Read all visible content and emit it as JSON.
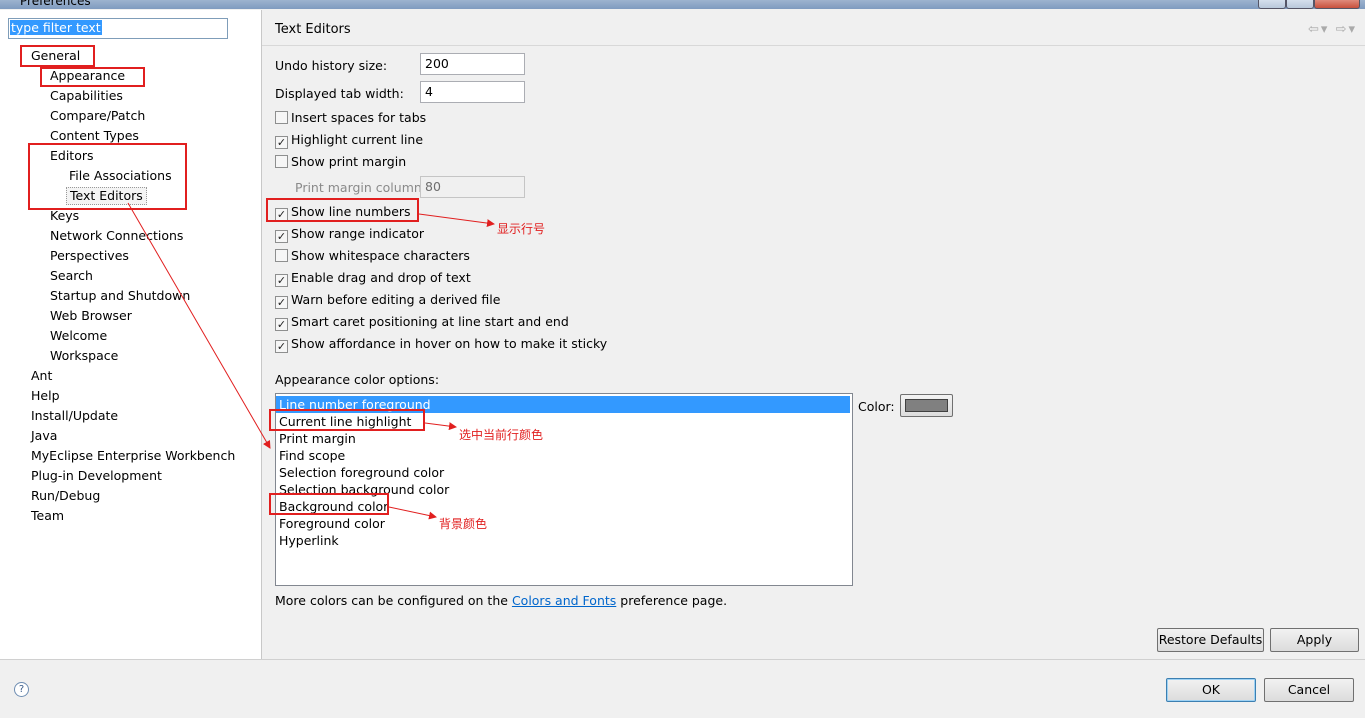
{
  "window": {
    "title": "Preferences"
  },
  "filter": {
    "text": "type filter text"
  },
  "tree": {
    "general": "General",
    "appearance": "Appearance",
    "capabilities": "Capabilities",
    "compare_patch": "Compare/Patch",
    "content_types": "Content Types",
    "editors": "Editors",
    "file_associations": "File Associations",
    "text_editors": "Text Editors",
    "keys": "Keys",
    "network_connections": "Network Connections",
    "perspectives": "Perspectives",
    "search": "Search",
    "startup_shutdown": "Startup and Shutdown",
    "web_browser": "Web Browser",
    "welcome": "Welcome",
    "workspace": "Workspace",
    "ant": "Ant",
    "help": "Help",
    "install_update": "Install/Update",
    "java": "Java",
    "myeclipse": "MyEclipse Enterprise Workbench",
    "plugin_dev": "Plug-in Development",
    "run_debug": "Run/Debug",
    "team": "Team"
  },
  "page": {
    "title": "Text Editors",
    "nav_icons": [
      "back-arrow-icon",
      "dropdown-icon",
      "forward-arrow-icon",
      "dropdown-icon"
    ],
    "undo_label": "Undo history size:",
    "undo_value": "200",
    "tab_label": "Displayed tab width:",
    "tab_value": "4",
    "print_margin_col_label": "Print margin column:",
    "print_margin_col_value": "80",
    "checkboxes": {
      "insert_spaces": {
        "label": "Insert spaces for tabs",
        "checked": false
      },
      "highlight_line": {
        "label": "Highlight current line",
        "checked": true
      },
      "print_margin": {
        "label": "Show print margin",
        "checked": false
      },
      "line_numbers": {
        "label": "Show line numbers",
        "checked": true
      },
      "range_indicator": {
        "label": "Show range indicator",
        "checked": true
      },
      "whitespace": {
        "label": "Show whitespace characters",
        "checked": false
      },
      "drag_drop": {
        "label": "Enable drag and drop of text",
        "checked": true
      },
      "warn_derived": {
        "label": "Warn before editing a derived file",
        "checked": true
      },
      "smart_caret": {
        "label": "Smart caret positioning at line start and end",
        "checked": true
      },
      "affordance": {
        "label": "Show affordance in hover on how to make it sticky",
        "checked": true
      }
    },
    "appearance_label": "Appearance color options:",
    "color_options": [
      "Line number foreground",
      "Current line highlight",
      "Print margin",
      "Find scope",
      "Selection foreground color",
      "Selection background color",
      "Background color",
      "Foreground color",
      "Hyperlink"
    ],
    "selected_option": "Line number foreground",
    "color_label": "Color:",
    "color_value": "#808080",
    "more_colors_prefix": "More colors can be configured on the",
    "more_colors_link": "Colors and Fonts",
    "more_colors_suffix": "preference page.",
    "restore_defaults": "Restore Defaults",
    "apply": "Apply"
  },
  "dialog": {
    "ok": "OK",
    "cancel": "Cancel",
    "help_icon": "help-icon"
  },
  "annotations": {
    "line_numbers_note": "显示行号",
    "current_line_note": "选中当前行颜色",
    "background_note": "背景颜色",
    "color": "#e11f1f"
  }
}
